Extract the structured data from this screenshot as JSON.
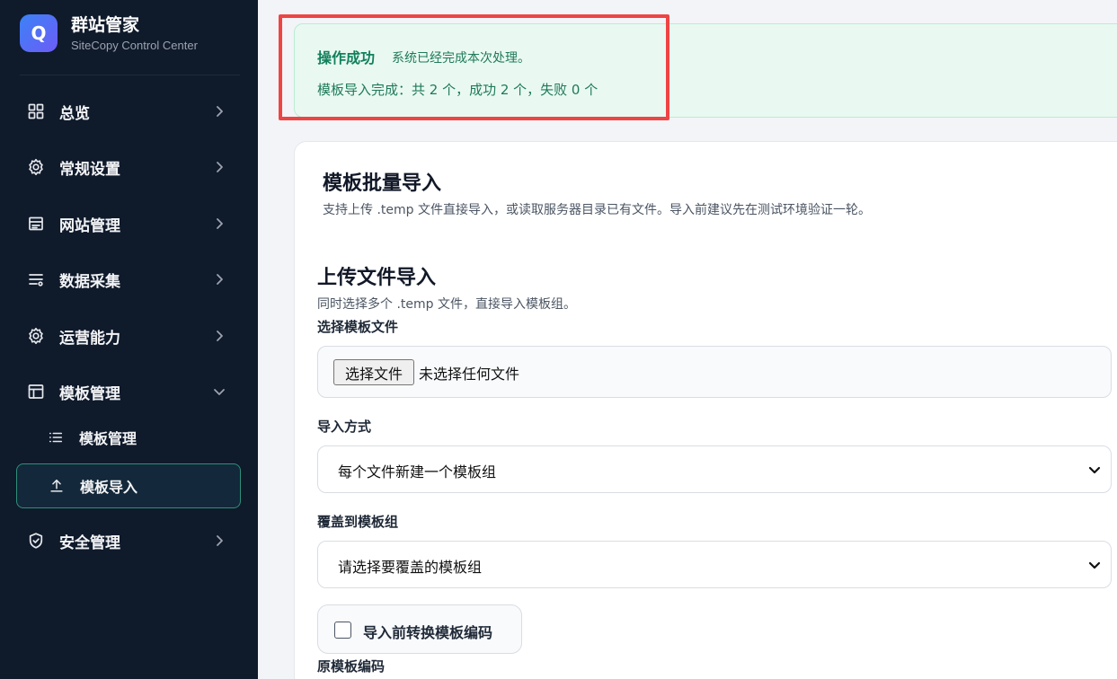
{
  "brand": {
    "logo_letter": "Q",
    "title": "群站管家",
    "subtitle": "SiteCopy Control Center"
  },
  "sidebar": {
    "items": [
      {
        "label": "总览",
        "icon": "grid-icon"
      },
      {
        "label": "常规设置",
        "icon": "gear-icon"
      },
      {
        "label": "网站管理",
        "icon": "server-icon"
      },
      {
        "label": "数据采集",
        "icon": "list-filter-icon"
      },
      {
        "label": "运营能力",
        "icon": "gear-icon"
      },
      {
        "label": "模板管理",
        "icon": "layout-icon",
        "expanded": true
      },
      {
        "label": "安全管理",
        "icon": "shield-icon"
      }
    ],
    "sub_items": [
      {
        "label": "模板管理",
        "icon": "list-icon"
      },
      {
        "label": "模板导入",
        "icon": "upload-icon",
        "active": true
      }
    ]
  },
  "alert": {
    "title": "操作成功",
    "message": "系统已经完成本次处理。",
    "detail": "模板导入完成：共 2 个，成功 2 个，失败 0 个"
  },
  "card": {
    "title": "模板批量导入",
    "description": "支持上传 .temp 文件直接导入，或读取服务器目录已有文件。导入前建议先在测试环境验证一轮。",
    "section_title": "上传文件导入",
    "section_description": "同时选择多个 .temp 文件，直接导入模板组。",
    "file_label": "选择模板文件",
    "file_button": "选择文件",
    "file_status": "未选择任何文件",
    "import_mode_label": "导入方式",
    "import_mode_value": "每个文件新建一个模板组",
    "overwrite_label": "覆盖到模板组",
    "overwrite_value": "请选择要覆盖的模板组",
    "convert_label": "导入前转换模板编码",
    "source_encoding_label": "原模板编码"
  },
  "colors": {
    "sidebar_bg": "#0f1a2b",
    "success": "#12805c",
    "highlight": "#ef4444"
  }
}
